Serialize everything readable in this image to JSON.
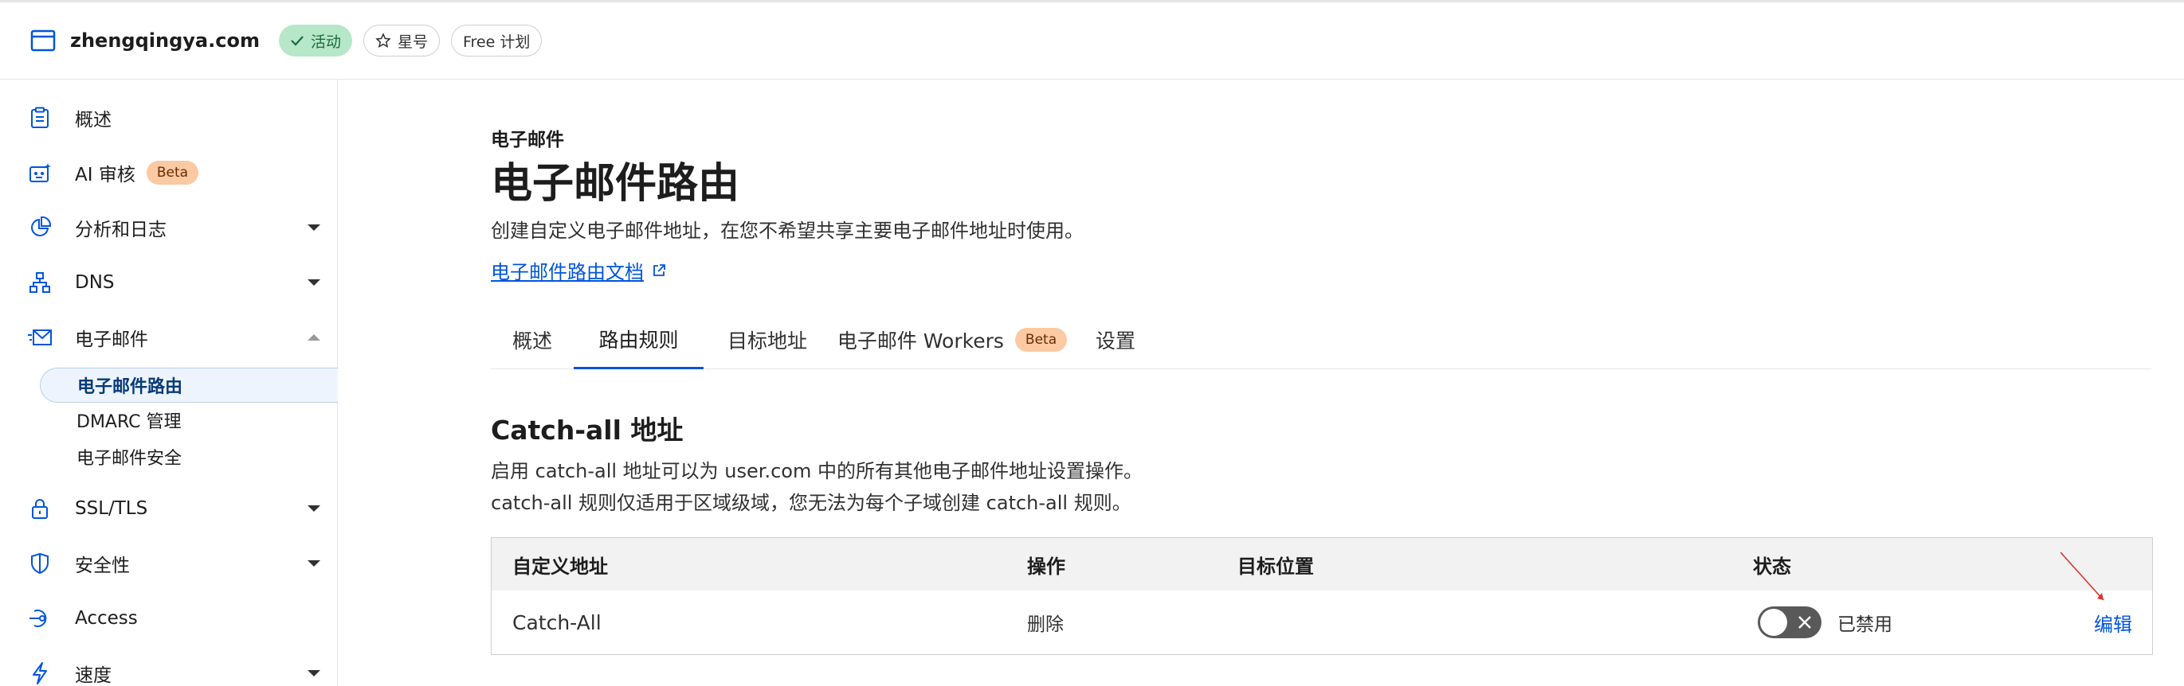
{
  "header": {
    "domain": "zhengqingya.com",
    "status_badge": "活动",
    "star_label": "星号",
    "plan_label": "Free 计划"
  },
  "sidebar": {
    "items": [
      {
        "label": "概述",
        "icon": "clipboard-icon"
      },
      {
        "label": "AI 审核",
        "icon": "robot-icon",
        "badge": "Beta"
      },
      {
        "label": "分析和日志",
        "icon": "pie-chart-icon",
        "expandable": true
      },
      {
        "label": "DNS",
        "icon": "network-icon",
        "expandable": true
      },
      {
        "label": "电子邮件",
        "icon": "email-icon",
        "expanded": true
      },
      {
        "label": "SSL/TLS",
        "icon": "lock-icon",
        "expandable": true
      },
      {
        "label": "安全性",
        "icon": "shield-icon",
        "expandable": true
      },
      {
        "label": "Access",
        "icon": "access-icon"
      },
      {
        "label": "速度",
        "icon": "lightning-icon",
        "expandable": true
      }
    ],
    "email_subitems": [
      {
        "label": "电子邮件路由",
        "selected": true
      },
      {
        "label": "DMARC 管理"
      },
      {
        "label": "电子邮件安全"
      }
    ]
  },
  "main": {
    "eyebrow": "电子邮件",
    "title": "电子邮件路由",
    "description": "创建自定义电子邮件地址，在您不希望共享主要电子邮件地址时使用。",
    "doc_link": "电子邮件路由文档",
    "tabs": [
      {
        "label": "概述"
      },
      {
        "label": "路由规则",
        "active": true
      },
      {
        "label": "目标地址"
      },
      {
        "label": "电子邮件 Workers",
        "badge": "Beta"
      },
      {
        "label": "设置"
      }
    ],
    "catchall": {
      "title": "Catch-all 地址",
      "desc_line1": "启用 catch-all 地址可以为 user.com 中的所有其他电子邮件地址设置操作。",
      "desc_line2": "catch-all 规则仅适用于区域级域，您无法为每个子域创建 catch-all 规则。",
      "columns": [
        "自定义地址",
        "操作",
        "目标位置",
        "状态"
      ],
      "row": {
        "address": "Catch-All",
        "action": "删除",
        "destination": "",
        "status": "已禁用",
        "enabled": false,
        "edit_label": "编辑"
      }
    }
  },
  "colors": {
    "accent": "#0055dc",
    "active_badge_bg": "#b6e7c8",
    "beta_badge_bg": "#fbc9a2",
    "annotation_arrow": "#e0312b"
  }
}
